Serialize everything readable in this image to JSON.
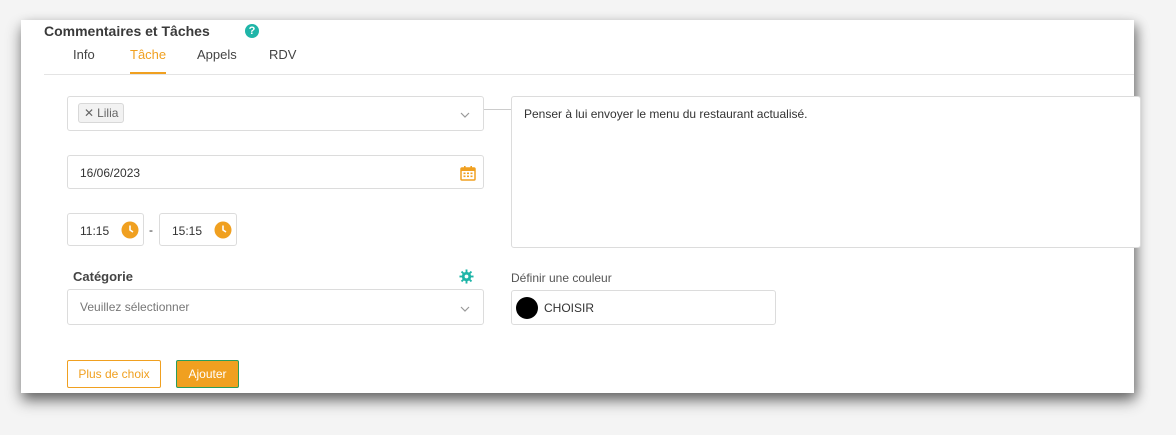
{
  "header": {
    "title": "Commentaires et Tâches"
  },
  "tabs": [
    {
      "label": "Info"
    },
    {
      "label": "Tâche"
    },
    {
      "label": "Appels"
    },
    {
      "label": "RDV"
    }
  ],
  "form": {
    "assignee_chip": "Lilia",
    "date": "16/06/2023",
    "time_start": "11:15",
    "time_separator": "-",
    "time_end": "15:15",
    "category_label": "Catégorie",
    "category_placeholder": "Veuillez sélectionner",
    "comment": "Penser à lui envoyer le menu du restaurant actualisé.",
    "color_label": "Définir une couleur",
    "color_button": "CHOISIR",
    "selected_color": "#000000"
  },
  "actions": {
    "more_choices": "Plus de choix",
    "add": "Ajouter"
  },
  "colors": {
    "accent": "#f0a020",
    "teal": "#1fb5a8"
  }
}
